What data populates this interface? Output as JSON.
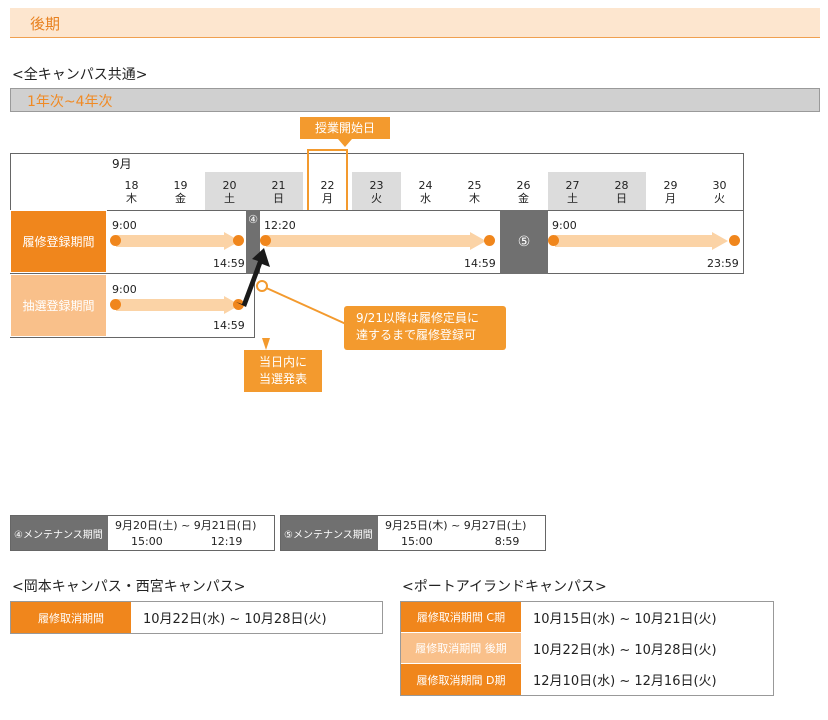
{
  "term_title": "後期",
  "all_campus_title": "<全キャンパス共通>",
  "year_range": "1年次~4年次",
  "class_start_label": "授業開始日",
  "calendar": {
    "month": "9月",
    "days": [
      {
        "num": "18",
        "dow": "木"
      },
      {
        "num": "19",
        "dow": "金"
      },
      {
        "num": "20",
        "dow": "土"
      },
      {
        "num": "21",
        "dow": "日"
      },
      {
        "num": "22",
        "dow": "月"
      },
      {
        "num": "23",
        "dow": "火"
      },
      {
        "num": "24",
        "dow": "水"
      },
      {
        "num": "25",
        "dow": "木"
      },
      {
        "num": "26",
        "dow": "金"
      },
      {
        "num": "27",
        "dow": "土"
      },
      {
        "num": "28",
        "dow": "日"
      },
      {
        "num": "29",
        "dow": "月"
      },
      {
        "num": "30",
        "dow": "火"
      }
    ],
    "highlighted_days": [
      "20",
      "21",
      "23",
      "27",
      "28"
    ],
    "class_start_day": "22"
  },
  "registration": {
    "label": "履修登録期間",
    "p1_start": "9:00",
    "p1_end": "14:59",
    "p2_start": "12:20",
    "p2_end": "14:59",
    "p3_start": "9:00",
    "p3_end": "23:59"
  },
  "lottery": {
    "label": "抽選登録期間",
    "start": "9:00",
    "end": "14:59"
  },
  "maint_mark_4": "④",
  "maint_mark_5": "⑤",
  "callout_lines": [
    "9/21以降は履修定員に",
    "達するまで履修登録可"
  ],
  "announce_lines": [
    "当日内に",
    "当選発表"
  ],
  "maintenance": [
    {
      "label": "④メンテナンス期間",
      "range": "9月20日(土) ~ 9月21日(日)",
      "time_start": "15:00",
      "time_end": "12:19"
    },
    {
      "label": "⑤メンテナンス期間",
      "range": "9月25日(木) ~ 9月27日(土)",
      "time_start": "15:00",
      "time_end": "8:59"
    }
  ],
  "okamoto": {
    "title": "<岡本キャンパス・西宮キャンパス>",
    "rows": [
      {
        "label": "履修取消期間",
        "range": "10月22日(水) ~ 10月28日(火)"
      }
    ]
  },
  "port": {
    "title": "<ポートアイランドキャンパス>",
    "rows": [
      {
        "label": "履修取消期間 C期",
        "range": "10月15日(水) ~ 10月21日(火)"
      },
      {
        "label": "履修取消期間 後期",
        "range": "10月22日(水) ~ 10月28日(火)"
      },
      {
        "label": "履修取消期間 D期",
        "range": "12月10日(水) ~ 12月16日(火)"
      }
    ]
  },
  "colors": {
    "accent": "#f39a2e",
    "dark_orange": "#f0861c",
    "light_orange": "#fbd3a6",
    "label_light": "#f9c08a",
    "maint_gray": "#707070",
    "highlight_gray": "#dcdcdc"
  }
}
